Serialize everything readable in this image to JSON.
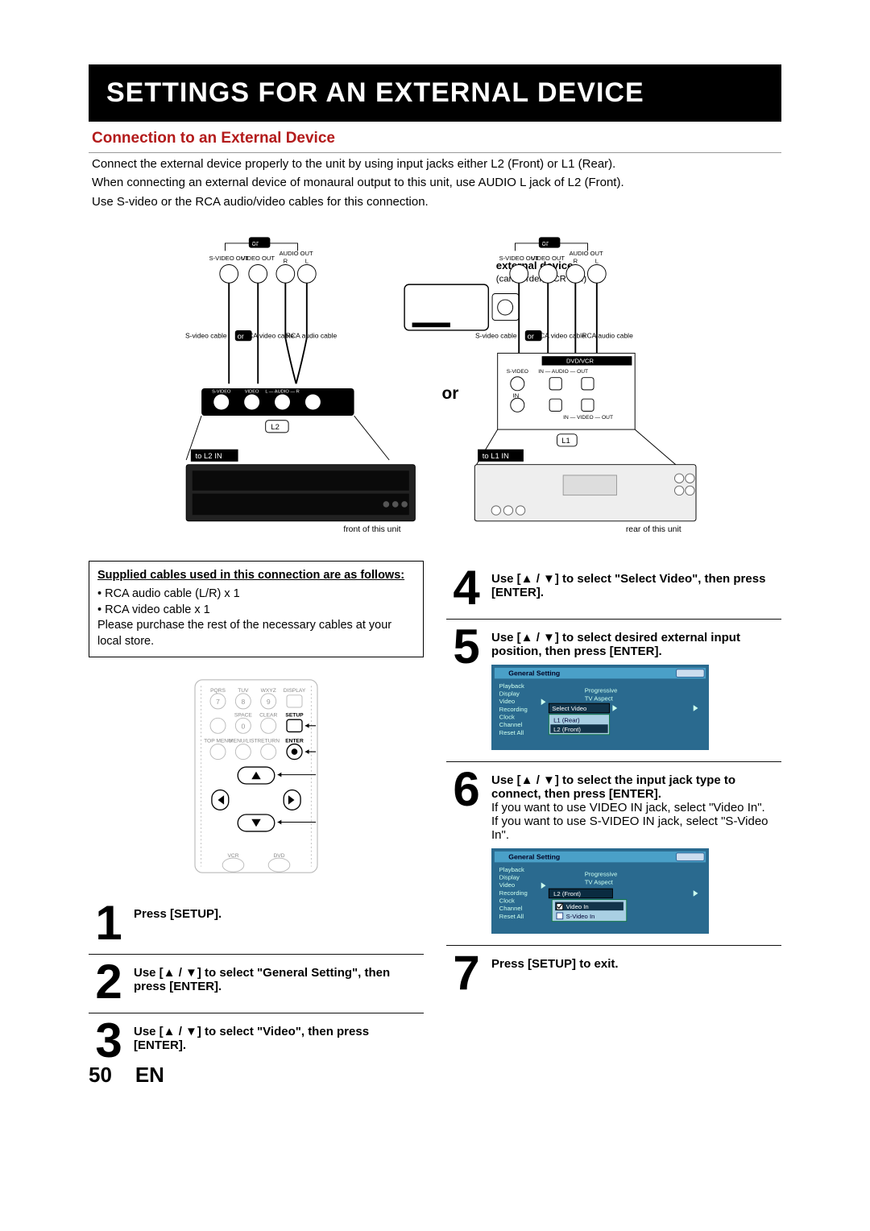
{
  "page_number": "50",
  "lang_code": "EN",
  "title": "SETTINGS FOR AN EXTERNAL DEVICE",
  "subtitle": "Connection to an External Device",
  "intro": [
    "Connect the external device properly to the unit by using input jacks either L2 (Front) or L1 (Rear).",
    "When connecting an external device of monaural output to this unit, use AUDIO L jack of L2 (Front).",
    "Use S-video or the RCA audio/video cables for this connection."
  ],
  "diagram": {
    "or": "or",
    "ext_title": "external device",
    "ext_sub": "(camcorder, VCR etc.)",
    "svideo_out": "S-VIDEO\nOUT",
    "video_out": "VIDEO\nOUT",
    "audio_out_r": "AUDIO OUT\nR",
    "audio_out_l": "L",
    "svideo_cable": "S-video\ncable",
    "rca_video_cable": "RCA\nvideo\ncable",
    "rca_audio_cable": "RCA\naudio\ncable",
    "rca_audio_cable2": "RCA\naudio cable",
    "to_l2": "to L2 IN",
    "to_l1": "to L1 IN",
    "front": "front of this unit",
    "rear": "rear of this unit",
    "L2": "L2",
    "L1": "L1",
    "svideo": "S-VIDEO",
    "video": "VIDEO",
    "audio_L": "L — AUDIO — R",
    "dvdvcr": "DVD/VCR",
    "in": "IN"
  },
  "supplied": {
    "header": "Supplied cables used in this connection are as follows:",
    "line1": "• RCA audio cable (L/R) x 1",
    "line2": "• RCA video cable x 1",
    "line3": "Please purchase the rest of the necessary cables at your local store."
  },
  "remote": {
    "pqrs": "PQRS",
    "tuv": "TUV",
    "wxyz": "WXYZ",
    "display": "DISPLAY",
    "space": "SPACE",
    "clear": "CLEAR",
    "setup": "SETUP",
    "topmenu": "TOP MENU",
    "menulist": "MENU/LIST",
    "return": "RETURN",
    "enter": "ENTER",
    "vcr": "VCR",
    "dvd": "DVD",
    "k7": "7",
    "k8": "8",
    "k9": "9",
    "k0": "0"
  },
  "steps": [
    {
      "n": "1",
      "text": "Press [SETUP]."
    },
    {
      "n": "2",
      "text": "Use [▲ / ▼] to select \"General Setting\", then press [ENTER]."
    },
    {
      "n": "3",
      "text": "Use [▲ / ▼] to select \"Video\", then press [ENTER]."
    },
    {
      "n": "4",
      "text": "Use [▲ / ▼] to select \"Select Video\", then press [ENTER]."
    },
    {
      "n": "5",
      "text": "Use [▲ / ▼] to select desired external input position, then press [ENTER]."
    },
    {
      "n": "6",
      "text": "Use [▲ / ▼] to select the input jack type to connect, then press [ENTER].",
      "extra": [
        "If you want to use VIDEO IN jack, select \"Video In\".",
        " If you want to use S-VIDEO IN jack, select \"S-Video In\"."
      ]
    },
    {
      "n": "7",
      "text": "Press [SETUP] to exit."
    }
  ],
  "menus": {
    "title": "General Setting",
    "left": [
      "Playback",
      "Display",
      "Video",
      "Recording",
      "Clock",
      "Channel",
      "Reset All"
    ],
    "step5_right_top": [
      "Progressive",
      "TV Aspect"
    ],
    "step5_sel": "Select Video",
    "step5_opts": [
      "L1 (Rear)",
      "L2 (Front)"
    ],
    "step6_right_top": [
      "Progressive",
      "TV Aspect"
    ],
    "step6_hdr": "L2 (Front)",
    "step6_opts": [
      "Video In",
      "S-Video In"
    ]
  }
}
